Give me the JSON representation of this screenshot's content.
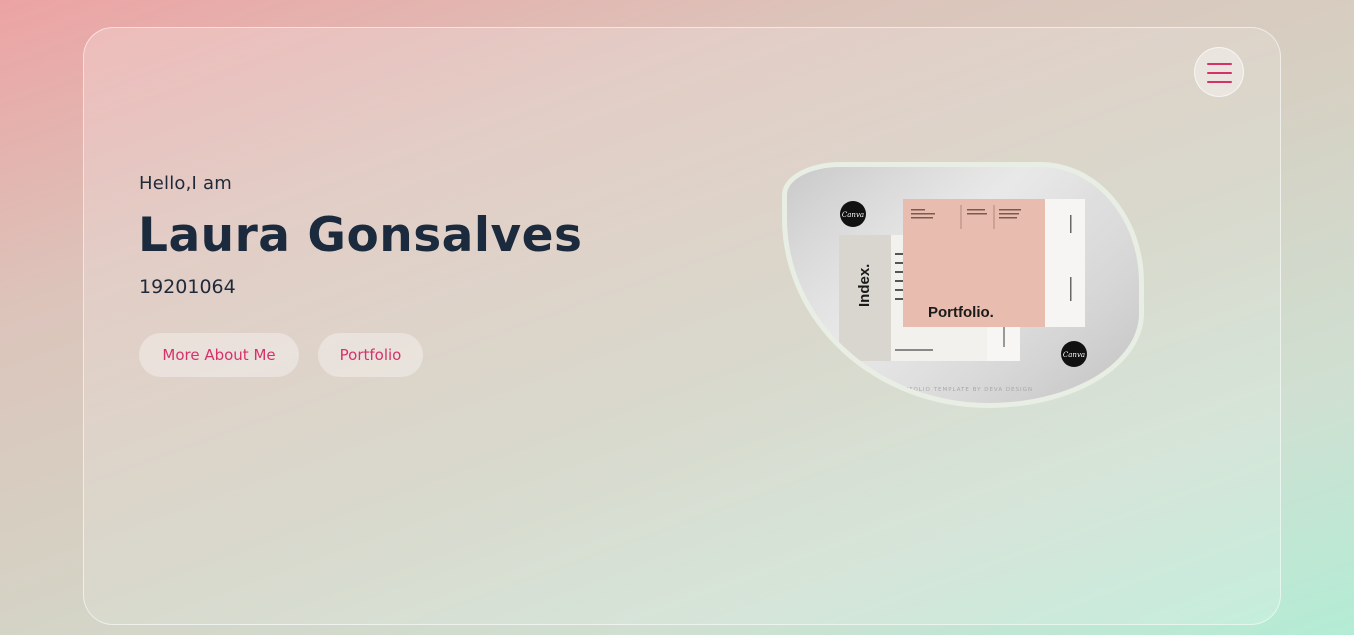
{
  "header": {
    "menu_icon": "hamburger-icon",
    "menu_icon_color": "#d6316b"
  },
  "hero": {
    "greeting": "Hello,I am",
    "name": "Laura Gonsalves",
    "student_id": "19201064",
    "buttons": {
      "about_label": "More About Me",
      "portfolio_label": "Portfolio"
    },
    "image": {
      "index_title": "Index.",
      "portfolio_title": "Portfolio.",
      "badge_text": "Canva",
      "caption": "PORTFOLIO TEMPLATE BY DEVA DESIGN"
    }
  },
  "colors": {
    "accent": "#d6316b",
    "heading": "#1b2a3c"
  }
}
